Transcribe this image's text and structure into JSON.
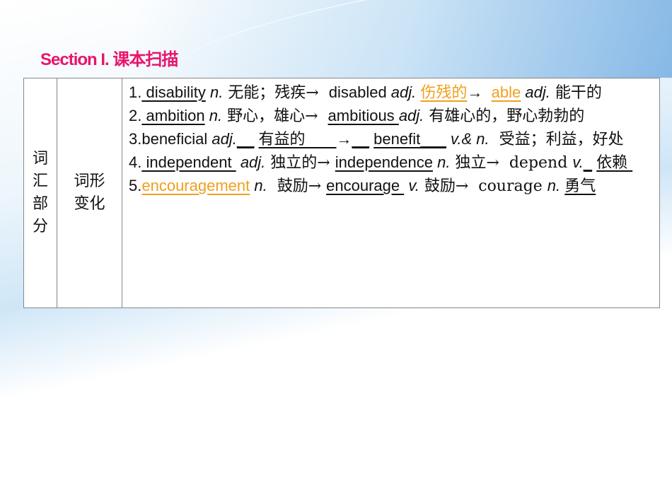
{
  "title": "Section I.  课本扫描",
  "table": {
    "category": "词汇部分",
    "subcategory": "词形变化",
    "entries": [
      {
        "segments": [
          {
            "t": "1."
          },
          {
            "t": " disability",
            "u": 1
          },
          {
            "t": " n.",
            "i": 1
          },
          {
            "t": " 无能；残疾→  "
          },
          {
            "t": "disabled"
          },
          {
            "t": " adj.",
            "i": 1
          },
          {
            "t": " "
          },
          {
            "t": "伤残的",
            "u": 1,
            "o": 1
          },
          {
            "t": "→  "
          },
          {
            "t": "able",
            "u": 1,
            "o": 1
          },
          {
            "t": " adj.",
            "i": 1
          },
          {
            "t": " 能干的"
          }
        ]
      },
      {
        "segments": [
          {
            "t": "2."
          },
          {
            "t": " ambition",
            "u": 1
          },
          {
            "t": " n.",
            "i": 1
          },
          {
            "t": " 野心，雄心→  "
          },
          {
            "t": "ambitious ",
            "u": 1
          },
          {
            "t": "adj.",
            "i": 1
          },
          {
            "t": " 有雄心的，野心勃勃的"
          }
        ]
      },
      {
        "segments": [
          {
            "t": "3.beneficial "
          },
          {
            "t": "adj.",
            "i": 1
          },
          {
            "t": "__",
            "u": 1
          },
          {
            "t": " "
          },
          {
            "t": "有益的____",
            "u": 1
          },
          {
            "t": "→"
          },
          {
            "t": "__",
            "u": 1
          },
          {
            "t": " "
          },
          {
            "t": "benefit___",
            "u": 1
          },
          {
            "t": " v.& n.",
            "i": 1
          },
          {
            "t": "  受益；利益，好处"
          }
        ]
      },
      {
        "segments": [
          {
            "t": "4."
          },
          {
            "t": " independent ",
            "u": 1
          },
          {
            "t": " adj.",
            "i": 1
          },
          {
            "t": " 独立的→ "
          },
          {
            "t": "independence",
            "u": 1
          },
          {
            "t": " n.",
            "i": 1
          },
          {
            "t": " 独立→  depend "
          },
          {
            "t": "v.",
            "i": 1
          },
          {
            "t": "_",
            "u": 1
          },
          {
            "t": " "
          },
          {
            "t": "依赖 ",
            "u": 1
          }
        ]
      },
      {
        "segments": [
          {
            "t": "5."
          },
          {
            "t": "encouragement",
            "u": 1,
            "o": 1
          },
          {
            "t": " n.",
            "i": 1
          },
          {
            "t": "  鼓励→ "
          },
          {
            "t": "encourage ",
            "u": 1
          },
          {
            "t": " v.",
            "i": 1
          },
          {
            "t": " 鼓励→  courage "
          },
          {
            "t": "n.",
            "i": 1
          },
          {
            "t": " "
          },
          {
            "t": "勇气",
            "u": 1
          }
        ]
      }
    ]
  },
  "colors": {
    "title": "#e8156b",
    "highlight": "#f0a020"
  }
}
